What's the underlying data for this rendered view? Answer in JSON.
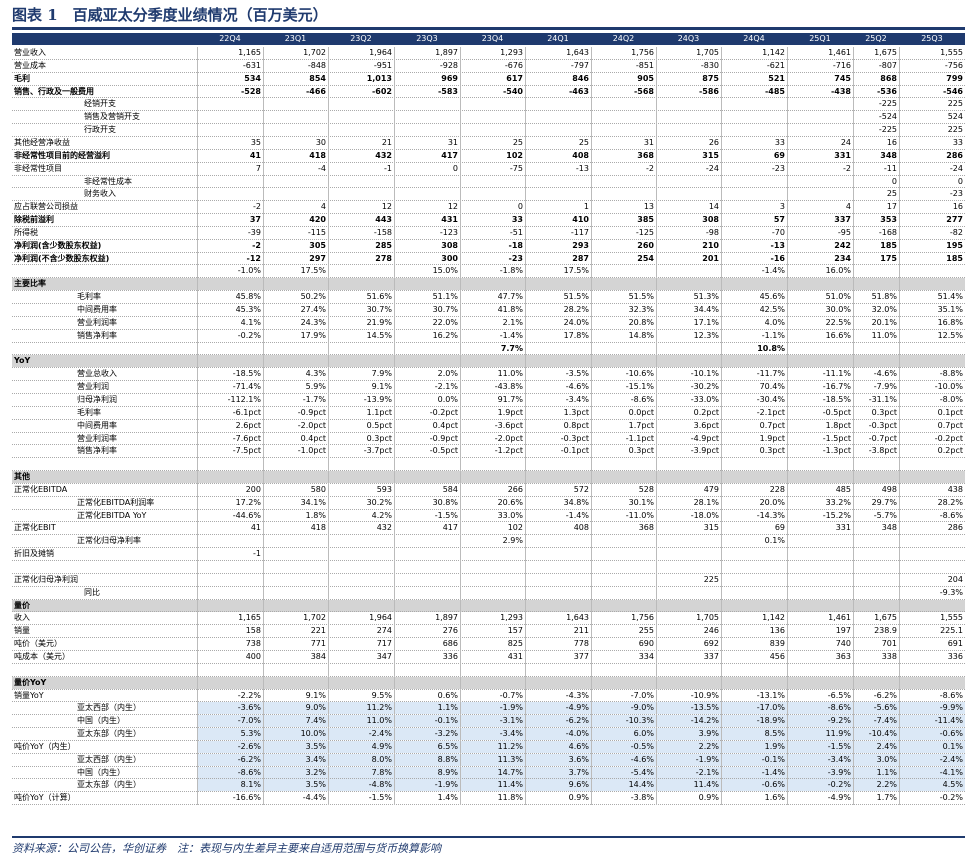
{
  "title": "图表 1　百威亚太分季度业绩情况（百万美元）",
  "source": "资料来源：公司公告，华创证券　注：表现与内生差异主要来自适用范围与货币换算影响",
  "quarters": [
    "22Q4",
    "23Q1",
    "23Q2",
    "23Q3",
    "23Q4",
    "24Q1",
    "24Q2",
    "24Q3",
    "24Q4",
    "25Q1",
    "25Q2",
    "25Q3"
  ],
  "rows": [
    {
      "label": "营业收入",
      "v": [
        "1,165",
        "1,702",
        "1,964",
        "1,897",
        "1,293",
        "1,643",
        "1,756",
        "1,705",
        "1,142",
        "1,461",
        "1,675",
        "1,555"
      ]
    },
    {
      "label": "营业成本",
      "v": [
        "-631",
        "-848",
        "-951",
        "-928",
        "-676",
        "-797",
        "-851",
        "-830",
        "-621",
        "-716",
        "-807",
        "-756"
      ]
    },
    {
      "label": "毛利",
      "b": 1,
      "v": [
        "534",
        "854",
        "1,013",
        "969",
        "617",
        "846",
        "905",
        "875",
        "521",
        "745",
        "868",
        "799"
      ]
    },
    {
      "label": "销售、行政及一般费用",
      "b": 1,
      "v": [
        "-528",
        "-466",
        "-602",
        "-583",
        "-540",
        "-463",
        "-568",
        "-586",
        "-485",
        "-438",
        "-536",
        "-546"
      ]
    },
    {
      "label": "经销开支",
      "ind": 1,
      "v": [
        "",
        "",
        "",
        "",
        "",
        "",
        "",
        "",
        "",
        "",
        "-225",
        "225"
      ]
    },
    {
      "label": "销售及营销开支",
      "ind": 1,
      "v": [
        "",
        "",
        "",
        "",
        "",
        "",
        "",
        "",
        "",
        "",
        "-524",
        "524"
      ]
    },
    {
      "label": "行政开支",
      "ind": 1,
      "v": [
        "",
        "",
        "",
        "",
        "",
        "",
        "",
        "",
        "",
        "",
        "-225",
        "225"
      ]
    },
    {
      "label": "其他经营净收益",
      "v": [
        "35",
        "30",
        "21",
        "31",
        "25",
        "25",
        "31",
        "26",
        "33",
        "24",
        "16",
        "33"
      ]
    },
    {
      "label": "非经常性项目前的经营溢利",
      "b": 1,
      "v": [
        "41",
        "418",
        "432",
        "417",
        "102",
        "408",
        "368",
        "315",
        "69",
        "331",
        "348",
        "286"
      ]
    },
    {
      "label": "非经常性项目",
      "v": [
        "7",
        "-4",
        "-1",
        "0",
        "-75",
        "-13",
        "-2",
        "-24",
        "-23",
        "-2",
        "-11",
        "-24"
      ]
    },
    {
      "label": "非经常性成本",
      "ind": 1,
      "v": [
        "",
        "",
        "",
        "",
        "",
        "",
        "",
        "",
        "",
        "",
        "0",
        "0"
      ]
    },
    {
      "label": "财务收入",
      "ind": 1,
      "v": [
        "",
        "",
        "",
        "",
        "",
        "",
        "",
        "",
        "",
        "",
        "25",
        "-23"
      ]
    },
    {
      "label": "应占联营公司损益",
      "v": [
        "-2",
        "4",
        "12",
        "12",
        "0",
        "1",
        "13",
        "14",
        "3",
        "4",
        "17",
        "16"
      ]
    },
    {
      "label": "除税前溢利",
      "b": 1,
      "v": [
        "37",
        "420",
        "443",
        "431",
        "33",
        "410",
        "385",
        "308",
        "57",
        "337",
        "353",
        "277"
      ]
    },
    {
      "label": "所得税",
      "v": [
        "-39",
        "-115",
        "-158",
        "-123",
        "-51",
        "-117",
        "-125",
        "-98",
        "-70",
        "-95",
        "-168",
        "-82"
      ]
    },
    {
      "label": "净利润(含少数股东权益)",
      "b": 1,
      "v": [
        "-2",
        "305",
        "285",
        "308",
        "-18",
        "293",
        "260",
        "210",
        "-13",
        "242",
        "185",
        "195"
      ]
    },
    {
      "label": "净利润(不含少数股东权益)",
      "b": 1,
      "v": [
        "-12",
        "297",
        "278",
        "300",
        "-23",
        "287",
        "254",
        "201",
        "-16",
        "234",
        "175",
        "185"
      ]
    },
    {
      "label": "",
      "v": [
        "-1.0%",
        "17.5%",
        "",
        "15.0%",
        "-1.8%",
        "17.5%",
        "",
        "",
        "-1.4%",
        "16.0%",
        "",
        ""
      ]
    },
    {
      "label": "主要比率",
      "sec": 1,
      "v": [
        "",
        "",
        "",
        "",
        "",
        "",
        "",
        "",
        "",
        "",
        "",
        ""
      ]
    },
    {
      "label": "毛利率",
      "ind": 2,
      "v": [
        "45.8%",
        "50.2%",
        "51.6%",
        "51.1%",
        "47.7%",
        "51.5%",
        "51.5%",
        "51.3%",
        "45.6%",
        "51.0%",
        "51.8%",
        "51.4%"
      ]
    },
    {
      "label": "中间费用率",
      "ind": 2,
      "v": [
        "45.3%",
        "27.4%",
        "30.7%",
        "30.7%",
        "41.8%",
        "28.2%",
        "32.3%",
        "34.4%",
        "42.5%",
        "30.0%",
        "32.0%",
        "35.1%"
      ]
    },
    {
      "label": "营业利润率",
      "ind": 2,
      "v": [
        "4.1%",
        "24.3%",
        "21.9%",
        "22.0%",
        "2.1%",
        "24.0%",
        "20.8%",
        "17.1%",
        "4.0%",
        "22.5%",
        "20.1%",
        "16.8%"
      ]
    },
    {
      "label": "销售净利率",
      "ind": 2,
      "v": [
        "-0.2%",
        "17.9%",
        "14.5%",
        "16.2%",
        "-1.4%",
        "17.8%",
        "14.8%",
        "12.3%",
        "-1.1%",
        "16.6%",
        "11.0%",
        "12.5%"
      ]
    },
    {
      "label": "",
      "bv": 1,
      "v": [
        "",
        "",
        "",
        "",
        "7.7%",
        "",
        "",
        "",
        "10.8%",
        "",
        "",
        ""
      ]
    },
    {
      "label": "YoY",
      "sec": 1,
      "v": [
        "",
        "",
        "",
        "",
        "",
        "",
        "",
        "",
        "",
        "",
        "",
        ""
      ]
    },
    {
      "label": "营业总收入",
      "ind": 2,
      "v": [
        "-18.5%",
        "4.3%",
        "7.9%",
        "2.0%",
        "11.0%",
        "-3.5%",
        "-10.6%",
        "-10.1%",
        "-11.7%",
        "-11.1%",
        "-4.6%",
        "-8.8%"
      ]
    },
    {
      "label": "营业利润",
      "ind": 2,
      "v": [
        "-71.4%",
        "5.9%",
        "9.1%",
        "-2.1%",
        "-43.8%",
        "-4.6%",
        "-15.1%",
        "-30.2%",
        "70.4%",
        "-16.7%",
        "-7.9%",
        "-10.0%"
      ]
    },
    {
      "label": "归母净利润",
      "ind": 2,
      "v": [
        "-112.1%",
        "-1.7%",
        "-13.9%",
        "0.0%",
        "91.7%",
        "-3.4%",
        "-8.6%",
        "-33.0%",
        "-30.4%",
        "-18.5%",
        "-31.1%",
        "-8.0%"
      ]
    },
    {
      "label": "毛利率",
      "ind": 2,
      "v": [
        "-6.1pct",
        "-0.9pct",
        "1.1pct",
        "-0.2pct",
        "1.9pct",
        "1.3pct",
        "0.0pct",
        "0.2pct",
        "-2.1pct",
        "-0.5pct",
        "0.3pct",
        "0.1pct"
      ]
    },
    {
      "label": "中间费用率",
      "ind": 2,
      "v": [
        "2.6pct",
        "-2.0pct",
        "0.5pct",
        "0.4pct",
        "-3.6pct",
        "0.8pct",
        "1.7pct",
        "3.6pct",
        "0.7pct",
        "1.8pct",
        "-0.3pct",
        "0.7pct"
      ]
    },
    {
      "label": "营业利润率",
      "ind": 2,
      "v": [
        "-7.6pct",
        "0.4pct",
        "0.3pct",
        "-0.9pct",
        "-2.0pct",
        "-0.3pct",
        "-1.1pct",
        "-4.9pct",
        "1.9pct",
        "-1.5pct",
        "-0.7pct",
        "-0.2pct"
      ]
    },
    {
      "label": "销售净利率",
      "ind": 2,
      "v": [
        "-7.5pct",
        "-1.0pct",
        "-3.7pct",
        "-0.5pct",
        "-1.2pct",
        "-0.1pct",
        "0.3pct",
        "-3.9pct",
        "0.3pct",
        "-1.3pct",
        "-3.8pct",
        "0.2pct"
      ]
    },
    {
      "label": "",
      "v": [
        "",
        "",
        "",
        "",
        "",
        "",
        "",
        "",
        "",
        "",
        "",
        ""
      ]
    },
    {
      "label": "其他",
      "sec": 1,
      "v": [
        "",
        "",
        "",
        "",
        "",
        "",
        "",
        "",
        "",
        "",
        "",
        ""
      ]
    },
    {
      "label": "正常化EBITDA",
      "v": [
        "200",
        "580",
        "593",
        "584",
        "266",
        "572",
        "528",
        "479",
        "228",
        "485",
        "498",
        "438"
      ]
    },
    {
      "label": "正常化EBITDA利润率",
      "ind": 2,
      "v": [
        "17.2%",
        "34.1%",
        "30.2%",
        "30.8%",
        "20.6%",
        "34.8%",
        "30.1%",
        "28.1%",
        "20.0%",
        "33.2%",
        "29.7%",
        "28.2%"
      ]
    },
    {
      "label": "正常化EBITDA YoY",
      "ind": 2,
      "v": [
        "-44.6%",
        "1.8%",
        "4.2%",
        "-1.5%",
        "33.0%",
        "-1.4%",
        "-11.0%",
        "-18.0%",
        "-14.3%",
        "-15.2%",
        "-5.7%",
        "-8.6%"
      ]
    },
    {
      "label": "正常化EBIT",
      "v": [
        "41",
        "418",
        "432",
        "417",
        "102",
        "408",
        "368",
        "315",
        "69",
        "331",
        "348",
        "286"
      ]
    },
    {
      "label": "正常化归母净利率",
      "ind": 2,
      "v": [
        "",
        "",
        "",
        "",
        "2.9%",
        "",
        "",
        "",
        "0.1%",
        "",
        "",
        ""
      ]
    },
    {
      "label": "折旧及摊销",
      "v": [
        "-1",
        "",
        "",
        "",
        "",
        "",
        "",
        "",
        "",
        "",
        "",
        ""
      ]
    },
    {
      "label": "",
      "v": [
        "",
        "",
        "",
        "",
        "",
        "",
        "",
        "",
        "",
        "",
        "",
        ""
      ]
    },
    {
      "label": "正常化归母净利润",
      "v": [
        "",
        "",
        "",
        "",
        "",
        "",
        "",
        "225",
        "",
        "",
        "",
        "204"
      ]
    },
    {
      "label": "同比",
      "ind": 1,
      "v": [
        "",
        "",
        "",
        "",
        "",
        "",
        "",
        "",
        "",
        "",
        "",
        "-9.3%"
      ]
    },
    {
      "label": "量价",
      "sec": 1,
      "v": [
        "",
        "",
        "",
        "",
        "",
        "",
        "",
        "",
        "",
        "",
        "",
        ""
      ]
    },
    {
      "label": "收入",
      "v": [
        "1,165",
        "1,702",
        "1,964",
        "1,897",
        "1,293",
        "1,643",
        "1,756",
        "1,705",
        "1,142",
        "1,461",
        "1,675",
        "1,555"
      ]
    },
    {
      "label": "销量",
      "v": [
        "158",
        "221",
        "274",
        "276",
        "157",
        "211",
        "255",
        "246",
        "136",
        "197",
        "238.9",
        "225.1"
      ]
    },
    {
      "label": "吨价（美元）",
      "v": [
        "738",
        "771",
        "717",
        "686",
        "825",
        "778",
        "690",
        "692",
        "839",
        "740",
        "701",
        "691"
      ]
    },
    {
      "label": "吨成本（美元）",
      "v": [
        "400",
        "384",
        "347",
        "336",
        "431",
        "377",
        "334",
        "337",
        "456",
        "363",
        "338",
        "336"
      ]
    },
    {
      "label": "",
      "v": [
        "",
        "",
        "",
        "",
        "",
        "",
        "",
        "",
        "",
        "",
        "",
        ""
      ]
    },
    {
      "label": "量价YoY",
      "sec": 1,
      "v": [
        "",
        "",
        "",
        "",
        "",
        "",
        "",
        "",
        "",
        "",
        "",
        ""
      ]
    },
    {
      "label": "销量YoY",
      "v": [
        "-2.2%",
        "9.1%",
        "9.5%",
        "0.6%",
        "-0.7%",
        "-4.3%",
        "-7.0%",
        "-10.9%",
        "-13.1%",
        "-6.5%",
        "-6.2%",
        "-8.6%"
      ]
    },
    {
      "label": "亚太西部（内生）",
      "ind": 2,
      "hl": 1,
      "v": [
        "-3.6%",
        "9.0%",
        "11.2%",
        "1.1%",
        "-1.9%",
        "-4.9%",
        "-9.0%",
        "-13.5%",
        "-17.0%",
        "-8.6%",
        "-5.6%",
        "-9.9%"
      ]
    },
    {
      "label": "中国（内生）",
      "ind": 2,
      "hl": 1,
      "v": [
        "-7.0%",
        "7.4%",
        "11.0%",
        "-0.1%",
        "-3.1%",
        "-6.2%",
        "-10.3%",
        "-14.2%",
        "-18.9%",
        "-9.2%",
        "-7.4%",
        "-11.4%"
      ]
    },
    {
      "label": "亚太东部（内生）",
      "ind": 2,
      "hl": 1,
      "v": [
        "5.3%",
        "10.0%",
        "-2.4%",
        "-3.2%",
        "-3.4%",
        "-4.0%",
        "6.0%",
        "3.9%",
        "8.5%",
        "11.9%",
        "-10.4%",
        "-0.6%"
      ]
    },
    {
      "label": "吨价YoY（内生）",
      "hl": 1,
      "v": [
        "-2.6%",
        "3.5%",
        "4.9%",
        "6.5%",
        "11.2%",
        "4.6%",
        "-0.5%",
        "2.2%",
        "1.9%",
        "-1.5%",
        "2.4%",
        "0.1%"
      ]
    },
    {
      "label": "亚太西部（内生）",
      "ind": 2,
      "hl": 1,
      "v": [
        "-6.2%",
        "3.4%",
        "8.0%",
        "8.8%",
        "11.3%",
        "3.6%",
        "-4.6%",
        "-1.9%",
        "-0.1%",
        "-3.4%",
        "3.0%",
        "-2.4%"
      ]
    },
    {
      "label": "中国（内生）",
      "ind": 2,
      "hl": 1,
      "v": [
        "-8.6%",
        "3.2%",
        "7.8%",
        "8.9%",
        "14.7%",
        "3.7%",
        "-5.4%",
        "-2.1%",
        "-1.4%",
        "-3.9%",
        "1.1%",
        "-4.1%"
      ]
    },
    {
      "label": "亚太东部（内生）",
      "ind": 2,
      "hl": 1,
      "v": [
        "8.1%",
        "3.5%",
        "-4.8%",
        "-1.9%",
        "11.4%",
        "9.6%",
        "14.4%",
        "11.4%",
        "-0.6%",
        "-0.2%",
        "2.2%",
        "4.5%"
      ]
    },
    {
      "label": "吨价YoY（计算）",
      "v": [
        "-16.6%",
        "-4.4%",
        "-1.5%",
        "1.4%",
        "11.8%",
        "0.9%",
        "-3.8%",
        "0.9%",
        "1.6%",
        "-4.9%",
        "1.7%",
        "-0.2%"
      ]
    }
  ]
}
